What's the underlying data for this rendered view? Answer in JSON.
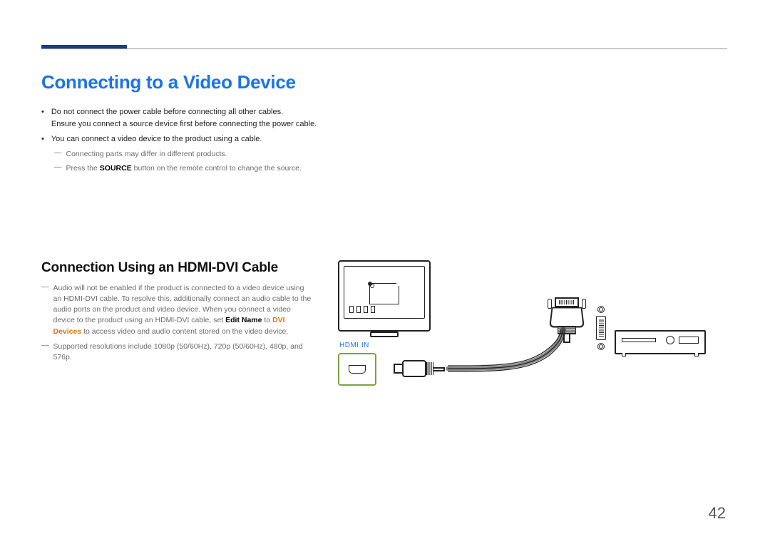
{
  "heading": "Connecting to a Video Device",
  "bullets": [
    {
      "line1": "Do not connect the power cable before connecting all other cables.",
      "line2": "Ensure you connect a source device first before connecting the power cable."
    },
    {
      "line1": "You can connect a video device to the product using a cable."
    }
  ],
  "subnotes": [
    "Connecting parts may differ in different products.",
    {
      "pre": "Press the ",
      "bold": "SOURCE",
      "post": " button on the remote control to change the source."
    }
  ],
  "section_heading": "Connection Using an HDMI-DVI Cable",
  "section_notes": [
    {
      "pre": "Audio will not be enabled if the product is connected to a video device using an HDMI-DVI cable. To resolve this, additionally connect an audio cable to the audio ports on the product and video device. When you connect a video device to the product using an HDMI-DVI cable, set ",
      "bold1": "Edit Name",
      "mid": " to ",
      "bold2": "DVI Devices",
      "post": " to access video and audio content stored on the video device."
    },
    {
      "text": "Supported resolutions include 1080p (50/60Hz), 720p (50/60Hz), 480p, and 576p."
    }
  ],
  "diagram": {
    "hdmi_in_label": "HDMI IN"
  },
  "page_number": "42"
}
